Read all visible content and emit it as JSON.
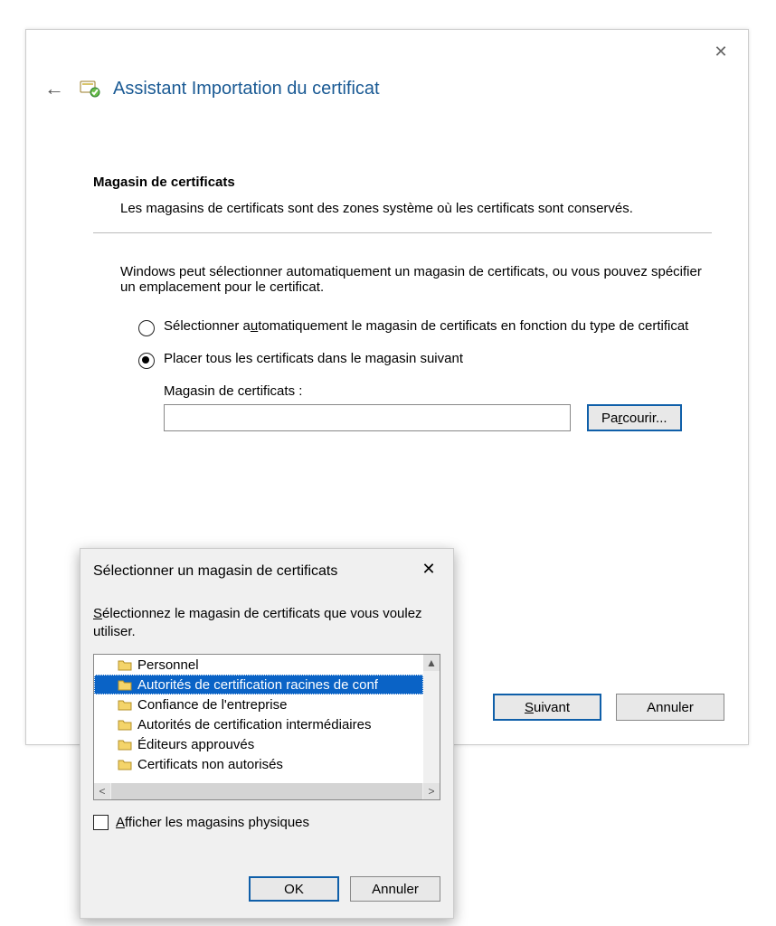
{
  "wizard": {
    "title": "Assistant Importation du certificat",
    "section_title": "Magasin de certificats",
    "section_subtitle": "Les magasins de certificats sont des zones système où les certificats sont conservés.",
    "intro": "Windows peut sélectionner automatiquement un magasin de certificats, ou vous pouvez spécifier un emplacement pour le certificat.",
    "radio_auto_pre": "Sélectionner a",
    "radio_auto_u": "u",
    "radio_auto_post": "tomatiquement le magasin de certificats en fonction du type de certificat",
    "radio_place": "Placer tous les certificats dans le magasin suivant",
    "store_label": "Magasin de certificats :",
    "store_value": "",
    "browse_pre": "Pa",
    "browse_u": "r",
    "browse_post": "courir...",
    "next_u": "S",
    "next_post": "uivant",
    "cancel": "Annuler"
  },
  "picker": {
    "title": "Sélectionner un magasin de certificats",
    "instr_u": "S",
    "instr_post": "électionnez le magasin de certificats que vous voulez utiliser.",
    "tree": [
      {
        "label": "Personnel",
        "selected": false
      },
      {
        "label": "Autorités de certification racines de conf",
        "selected": true
      },
      {
        "label": "Confiance de l'entreprise",
        "selected": false
      },
      {
        "label": "Autorités de certification intermédiaires",
        "selected": false
      },
      {
        "label": "Éditeurs approuvés",
        "selected": false
      },
      {
        "label": "Certificats non autorisés",
        "selected": false
      }
    ],
    "show_physical_u": "A",
    "show_physical_post": "fficher les magasins physiques",
    "ok": "OK",
    "cancel": "Annuler"
  }
}
